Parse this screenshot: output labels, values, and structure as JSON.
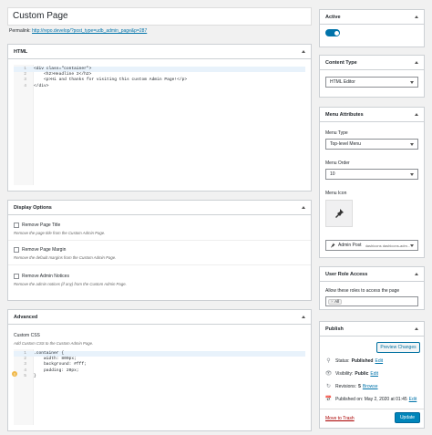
{
  "title": "Custom Page",
  "permalink": {
    "label": "Permalink:",
    "url": "http://repo.develop/?post_type=udb_admin_page&p=287"
  },
  "html_box": {
    "heading": "HTML",
    "lines": [
      {
        "n": "1",
        "text": "<div class=\"container\">"
      },
      {
        "n": "2",
        "text": "    <h2>Headline 2</h2>"
      },
      {
        "n": "3",
        "text": "    <p>Hi and thanks for visiting this custom Admin Page!</p>"
      },
      {
        "n": "4",
        "text": "</div>"
      }
    ]
  },
  "display_options": {
    "heading": "Display Options",
    "items": [
      {
        "label": "Remove Page Title",
        "desc": "Remove the page title from the Custom Admin Page."
      },
      {
        "label": "Remove Page Margin",
        "desc": "Remove the default margins from the Custom Admin Page."
      },
      {
        "label": "Remove Admin Notices",
        "desc": "Remove the admin notices (if any) from the Custom Admin Page."
      }
    ]
  },
  "advanced": {
    "heading": "Advanced",
    "css_label": "Custom CSS",
    "css_desc": "Add Custom CSS to the Custom Admin Page.",
    "lines": [
      {
        "n": "1",
        "text": ".container {"
      },
      {
        "n": "2",
        "text": "    width: 800px;"
      },
      {
        "n": "3",
        "text": "    background: #fff;"
      },
      {
        "n": "4",
        "text": "    padding: 20px;"
      },
      {
        "n": "5",
        "text": "}"
      }
    ]
  },
  "active_box": {
    "heading": "Active",
    "on": true
  },
  "content_type": {
    "heading": "Content Type",
    "value": "HTML Editor"
  },
  "menu_attributes": {
    "heading": "Menu Attributes",
    "type_label": "Menu Type",
    "type_value": "Top-level Menu",
    "order_label": "Menu Order",
    "order_value": "10",
    "icon_label": "Menu Icon",
    "icon_value": "Admin Post",
    "icon_class": "dashicons dashicons-adm..."
  },
  "user_role": {
    "heading": "User Role Access",
    "label": "Allow these roles to access the page",
    "tag": "All",
    "tag_remove": "×"
  },
  "publish": {
    "heading": "Publish",
    "preview": "Preview Changes",
    "status_label": "Status:",
    "status_value": "Published",
    "visibility_label": "Visibility:",
    "visibility_value": "Public",
    "revisions_label": "Revisions:",
    "revisions_count": "5",
    "browse": "Browse",
    "published_on": "Published on: May 2, 2020 at 01:45",
    "edit": "Edit",
    "trash": "Move to Trash",
    "update": "Update"
  },
  "colors": {
    "accent": "#0073aa",
    "primary_button": "#0085ba",
    "danger": "#a00",
    "warning": "#f0b849"
  }
}
